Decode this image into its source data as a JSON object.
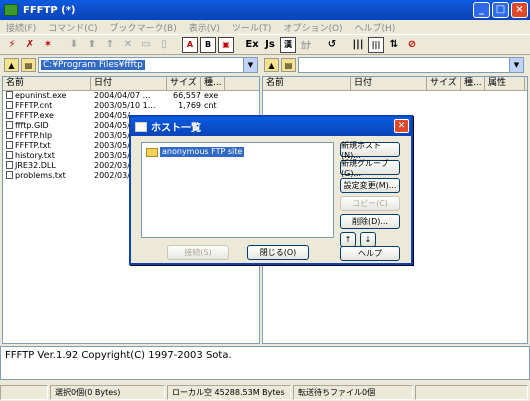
{
  "window": {
    "title": "FFFTP (*)",
    "controls": [
      "_",
      "□",
      "×"
    ]
  },
  "menu": [
    "接続(F)",
    "コマンド(C)",
    "ブックマーク(B)",
    "表示(V)",
    "ツール(T)",
    "オプション(O)",
    "ヘルプ(H)"
  ],
  "toolbar": {
    "buttons": [
      "connect",
      "disconnect",
      "quick-connect",
      "download",
      "upload",
      "mirror-upload",
      "delete",
      "rename",
      "mkdir",
      "ascii",
      "binary",
      "auto",
      "ex",
      "js",
      "kanji",
      "kana",
      "refresh",
      "list",
      "detail",
      "sync",
      "stop"
    ],
    "labels": {
      "ascii": "A",
      "binary": "B",
      "ex": "Ex",
      "js": "Js",
      "kanji": "漢",
      "kana": "ｶﾅ"
    }
  },
  "local_path": "C:¥Program Files¥ffftp",
  "remote_path": "",
  "local_pane": {
    "columns": [
      "名前",
      "日付",
      "サイズ",
      "種..."
    ],
    "rows": [
      {
        "name": "epuninst.exe",
        "date": "2004/04/07 ...",
        "size": "66,557",
        "type": "exe"
      },
      {
        "name": "FFFTP.cnt",
        "date": "2003/05/10 1...",
        "size": "1,769",
        "type": "cnt"
      },
      {
        "name": "FFFTP.exe",
        "date": "2004/05/",
        "size": "",
        "type": ""
      },
      {
        "name": "ffftp.GID",
        "date": "2004/05/",
        "size": "",
        "type": ""
      },
      {
        "name": "FFFTP.hlp",
        "date": "2003/05/",
        "size": "",
        "type": ""
      },
      {
        "name": "FFFTP.txt",
        "date": "2003/05/",
        "size": "",
        "type": ""
      },
      {
        "name": "history.txt",
        "date": "2003/05/",
        "size": "",
        "type": ""
      },
      {
        "name": "JRE32.DLL",
        "date": "2002/03/",
        "size": "",
        "type": ""
      },
      {
        "name": "problems.txt",
        "date": "2002/03/",
        "size": "",
        "type": ""
      }
    ]
  },
  "remote_pane": {
    "columns": [
      "名前",
      "日付",
      "サイズ",
      "種...",
      "属性"
    ]
  },
  "dialog": {
    "title": "ホスト一覧",
    "host": "anonymous FTP site",
    "buttons": {
      "new_host": "新規ホスト(N)...",
      "new_group": "新規グループ(G)...",
      "edit": "設定変更(M)...",
      "copy": "コピー(C)",
      "delete": "削除(D)...",
      "up": "↑",
      "down": "↓",
      "help": "ヘルプ",
      "connect": "接続(S)",
      "close": "閉じる(O)"
    }
  },
  "log": "FFFTP Ver.1.92 Copyright(C) 1997-2003 Sota.",
  "status": {
    "selected": "選択0個(0 Bytes)",
    "local_free": "ローカル空 45288.53M Bytes",
    "queue": "転送待ちファイル0個"
  }
}
